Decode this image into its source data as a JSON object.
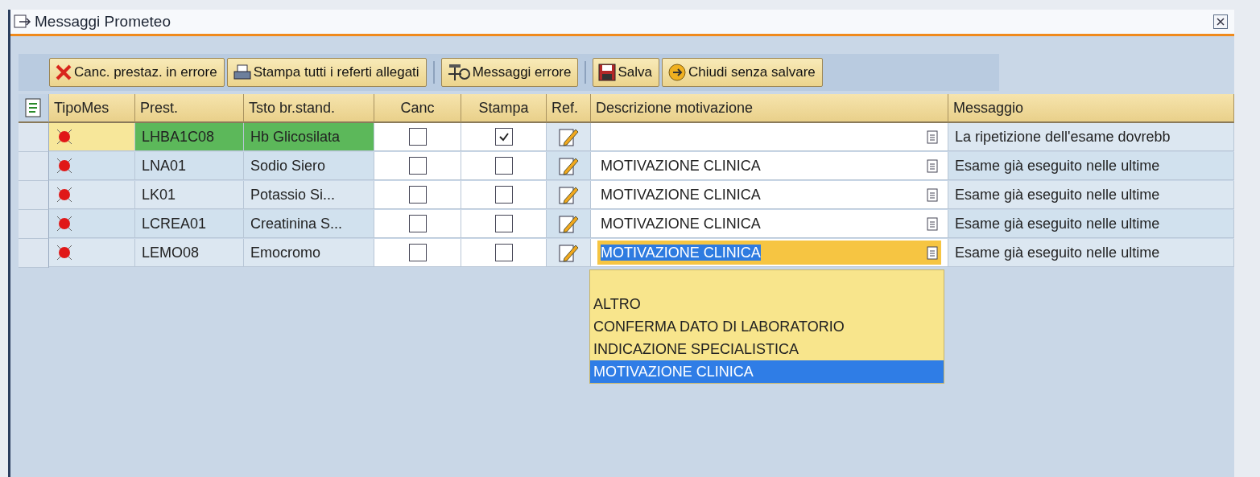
{
  "window": {
    "title": "Messaggi Prometeo"
  },
  "toolbar": {
    "groups": [
      [
        {
          "kind": "delete",
          "label": "Canc. prestaz. in errore"
        },
        {
          "kind": "print",
          "label": "Stampa tutti i referti allegati"
        }
      ],
      [
        {
          "kind": "messages",
          "label": "Messaggi errore"
        }
      ],
      [
        {
          "kind": "save",
          "label": "Salva"
        },
        {
          "kind": "close",
          "label": "Chiudi senza salvare"
        }
      ]
    ]
  },
  "table": {
    "columns": [
      "TipoMes",
      "Prest.",
      "Tsto br.stand.",
      "Canc",
      "Stampa",
      "Ref.",
      "Descrizione motivazione",
      "Messaggio"
    ],
    "rows": [
      {
        "code": "LHBA1C08",
        "description": "Hb Glicosilata",
        "canc": false,
        "stampa": true,
        "motivation": "",
        "message": "La ripetizione dell'esame dovrebb",
        "highlighted": true,
        "focused": false
      },
      {
        "code": "LNA01",
        "description": "Sodio Siero",
        "canc": false,
        "stampa": false,
        "motivation": "MOTIVAZIONE CLINICA",
        "message": "Esame già eseguito nelle ultime",
        "highlighted": false,
        "focused": false
      },
      {
        "code": "LK01",
        "description": "Potassio Si...",
        "canc": false,
        "stampa": false,
        "motivation": "MOTIVAZIONE CLINICA",
        "message": "Esame già eseguito nelle ultime",
        "highlighted": false,
        "focused": false
      },
      {
        "code": "LCREA01",
        "description": "Creatinina S...",
        "canc": false,
        "stampa": false,
        "motivation": "MOTIVAZIONE CLINICA",
        "message": "Esame già eseguito nelle ultime",
        "highlighted": false,
        "focused": false
      },
      {
        "code": "LEMO08",
        "description": "Emocromo",
        "canc": false,
        "stampa": false,
        "motivation": "MOTIVAZIONE CLINICA",
        "message": "Esame già eseguito nelle ultime",
        "highlighted": false,
        "focused": true
      }
    ]
  },
  "dropdown": {
    "options": [
      {
        "label": "ALTRO",
        "selected": false
      },
      {
        "label": "CONFERMA DATO DI LABORATORIO",
        "selected": false
      },
      {
        "label": "INDICAZIONE SPECIALISTICA",
        "selected": false
      },
      {
        "label": "MOTIVAZIONE CLINICA",
        "selected": true
      }
    ]
  }
}
